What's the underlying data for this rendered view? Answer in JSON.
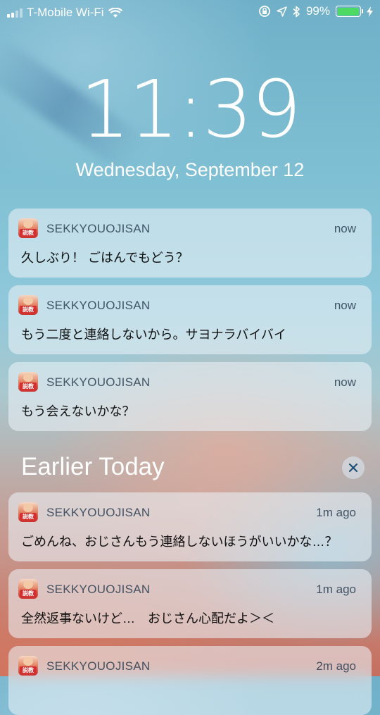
{
  "status": {
    "carrier": "T-Mobile Wi-Fi",
    "battery": "99%",
    "battery_level": 0.99,
    "colors": {
      "battery": "#4cd964"
    }
  },
  "lock": {
    "time": "11:39",
    "date": "Wednesday, September 12"
  },
  "section": {
    "title": "Earlier Today"
  },
  "notifications": [
    {
      "app": "SEKKYOUOJISAN",
      "time": "now",
      "message": "久しぶり！ ごはんでもどう？",
      "icon_badge": "説教"
    },
    {
      "app": "SEKKYOUOJISAN",
      "time": "now",
      "message": "もう二度と連絡しないから。サヨナラバイバイ",
      "icon_badge": "説教"
    },
    {
      "app": "SEKKYOUOJISAN",
      "time": "now",
      "message": "もう会えないかな？",
      "icon_badge": "説教"
    },
    {
      "app": "SEKKYOUOJISAN",
      "time": "1m ago",
      "message": "ごめんね、おじさんもう連絡しないほうがいいかな…？",
      "icon_badge": "説教"
    },
    {
      "app": "SEKKYOUOJISAN",
      "time": "1m ago",
      "message": "全然返事ないけど…　おじさん心配だよ＞＜",
      "icon_badge": "説教"
    },
    {
      "app": "SEKKYOUOJISAN",
      "time": "2m ago",
      "message": "",
      "icon_badge": "説教"
    }
  ]
}
